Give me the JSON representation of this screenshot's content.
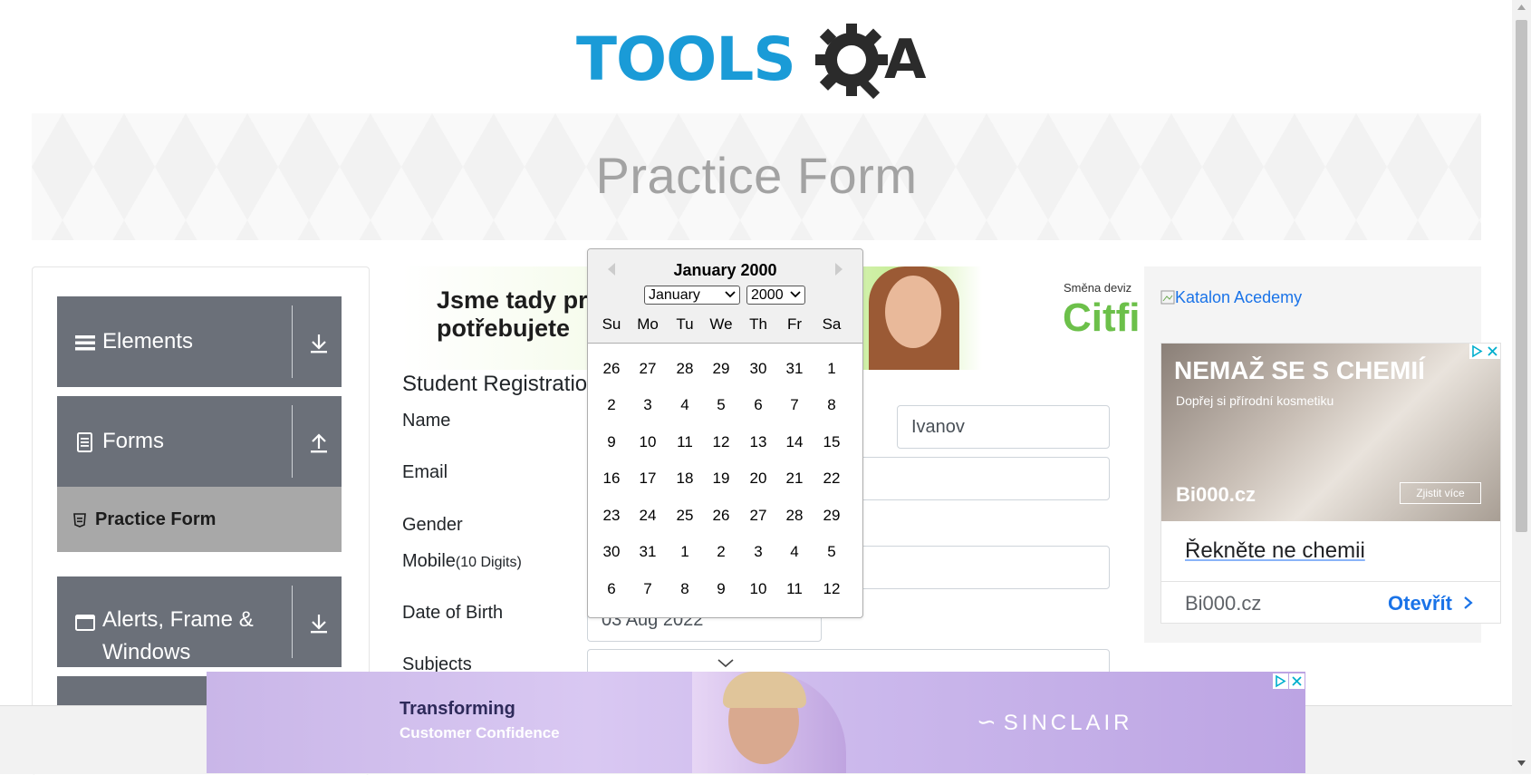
{
  "logo": {
    "text_left": "TOOLS",
    "text_right": "QA",
    "colors": {
      "blue": "#1a9bd7",
      "dark": "#2b2b2b"
    }
  },
  "banner": {
    "title": "Practice Form"
  },
  "sidebar": {
    "groups": [
      {
        "label": "Elements",
        "icon": "hamburger-icon",
        "arrow": "download-arrow-icon"
      },
      {
        "label": "Forms",
        "icon": "document-icon",
        "arrow": "upload-arrow-icon"
      },
      {
        "label": "Alerts, Frame &",
        "label2": "Windows",
        "icon": "window-icon",
        "arrow": "download-arrow-icon"
      }
    ],
    "active_item": {
      "label": "Practice Form",
      "icon": "html-icon"
    }
  },
  "form": {
    "heading": "Student Registratio",
    "labels": {
      "name": "Name",
      "email": "Email",
      "gender": "Gender",
      "mobile": "Mobile",
      "mobile_hint": "(10 Digits)",
      "dob": "Date of Birth",
      "subjects": "Subjects"
    },
    "last_name_value": "Ivanov",
    "dob_value": "03 Aug 2022"
  },
  "datepicker": {
    "title": "January 2000",
    "month_select": "January",
    "year_select": "2000",
    "day_names": [
      "Su",
      "Mo",
      "Tu",
      "We",
      "Th",
      "Fr",
      "Sa"
    ],
    "weeks": [
      [
        "26",
        "27",
        "28",
        "29",
        "30",
        "31",
        "1"
      ],
      [
        "2",
        "3",
        "4",
        "5",
        "6",
        "7",
        "8"
      ],
      [
        "9",
        "10",
        "11",
        "12",
        "13",
        "14",
        "15"
      ],
      [
        "16",
        "17",
        "18",
        "19",
        "20",
        "21",
        "22"
      ],
      [
        "23",
        "24",
        "25",
        "26",
        "27",
        "28",
        "29"
      ],
      [
        "30",
        "31",
        "1",
        "2",
        "3",
        "4",
        "5"
      ],
      [
        "6",
        "7",
        "8",
        "9",
        "10",
        "11",
        "12"
      ]
    ]
  },
  "ads": {
    "top_banner": {
      "line1": "Jsme tady pr",
      "line2": "potřebujete",
      "right_small": "Směna deviz",
      "right_big": "Citfi"
    },
    "right": {
      "alt_link": "Katalon Acedemy",
      "headline": "NEMAŽ SE S CHEMIÍ",
      "subline": "Dopřej si přírodní kosmetiku",
      "brand_logo": "Bi000.cz",
      "cta_small": "Zjistit více",
      "title": "Řekněte ne chemii",
      "domain": "Bi000.cz",
      "open": "Otevřít"
    },
    "bottom": {
      "line1": "Transforming",
      "line2": "Customer Confidence",
      "brand": "SINCLAIR"
    }
  }
}
